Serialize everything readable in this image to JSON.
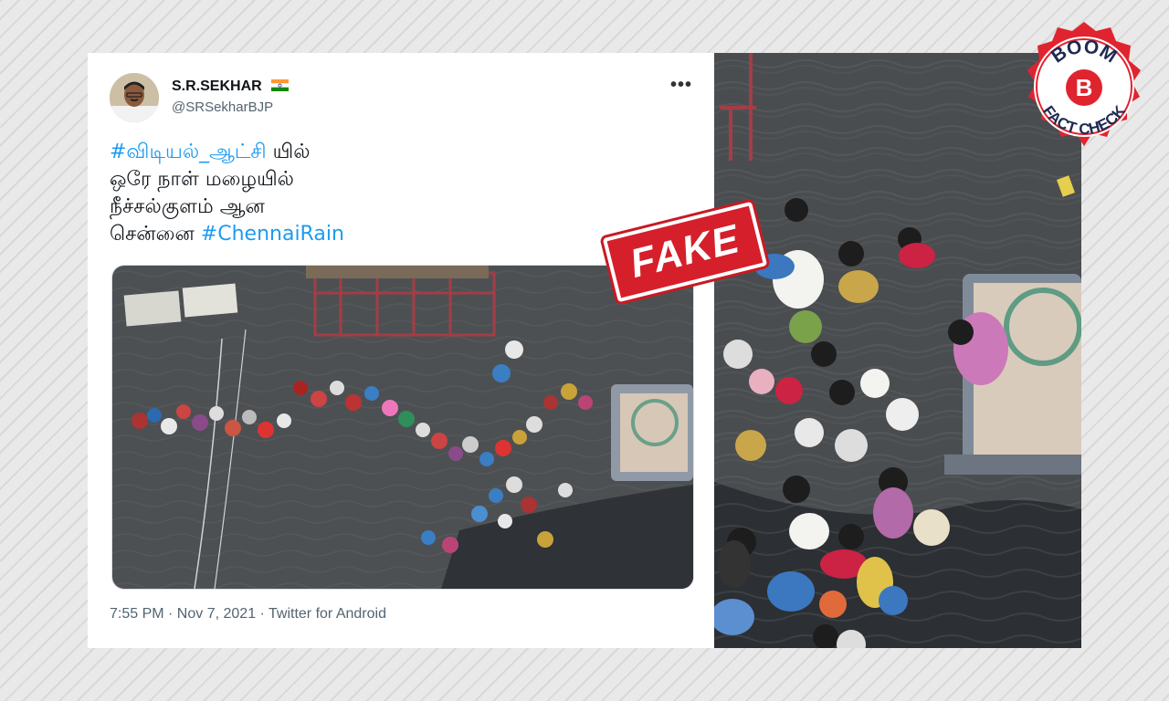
{
  "tweet": {
    "display_name": "S.R.SEKHAR",
    "handle": "@SRSekharBJP",
    "more_label": "•••",
    "text": {
      "hashtag1": "#விடியல்_ஆட்சி",
      "line1_rest": " யில்",
      "line2": "ஒரே நாள் மழையில்",
      "line3": "நீச்சல்குளம் ஆன",
      "line4_start": "சென்னை ",
      "hashtag2": "#ChennaiRain"
    },
    "meta": "7:55 PM · Nov 7, 2021 · Twitter for Android"
  },
  "stamp": {
    "label": "FAKE",
    "color": "#d51f2a"
  },
  "badge": {
    "name": "BOOM",
    "letter": "B",
    "subtitle": "FACT CHECK",
    "color": "#e0242f"
  },
  "colors": {
    "link": "#1d9bf0",
    "water": "#4a4d50"
  }
}
